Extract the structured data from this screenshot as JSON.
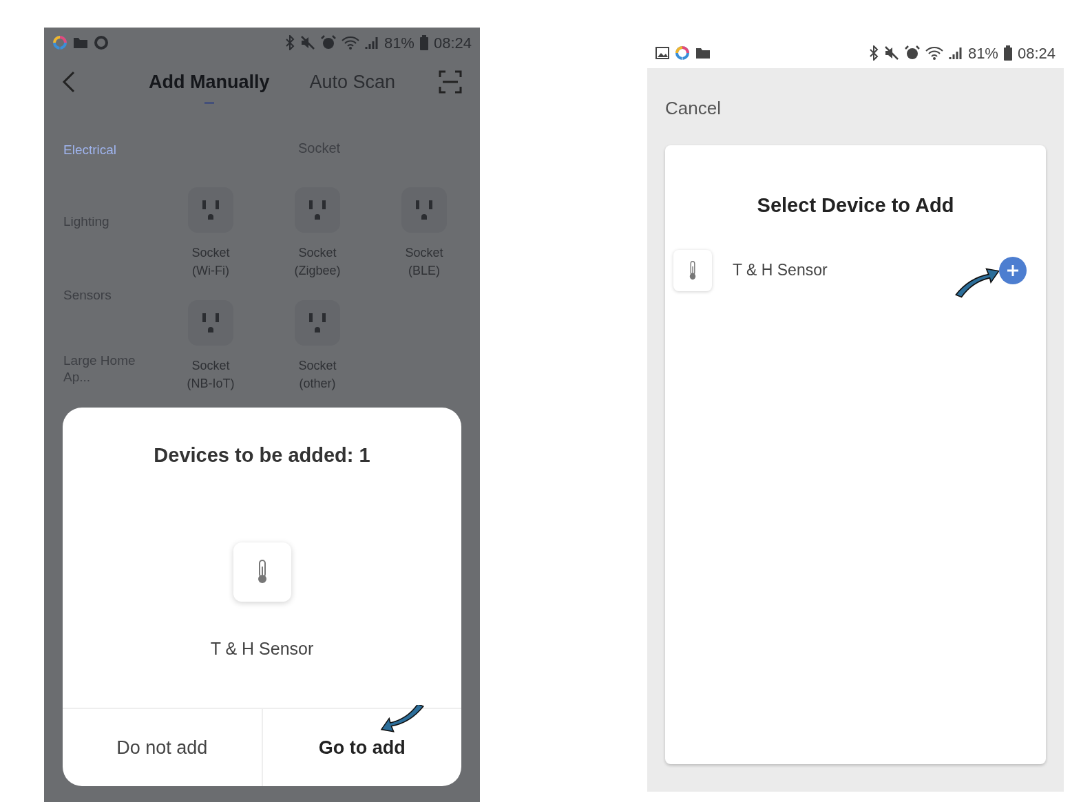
{
  "left_screen": {
    "status_bar": {
      "battery": "81%",
      "time": "08:24"
    },
    "tabs": [
      {
        "label": "Add Manually",
        "selected": true
      },
      {
        "label": "Auto Scan",
        "selected": false
      }
    ],
    "categories": [
      {
        "label": "Electrical",
        "selected": true
      },
      {
        "label": "Lighting",
        "selected": false
      },
      {
        "label": "Sensors",
        "selected": false
      },
      {
        "label": "Large Home Ap...",
        "selected": false
      }
    ],
    "section_title": "Socket",
    "devices": [
      {
        "name": "Socket",
        "variant": "(Wi-Fi)"
      },
      {
        "name": "Socket",
        "variant": "(Zigbee)"
      },
      {
        "name": "Socket",
        "variant": "(BLE)"
      },
      {
        "name": "Socket",
        "variant": "(NB-IoT)"
      },
      {
        "name": "Socket",
        "variant": "(other)"
      }
    ],
    "dialog": {
      "title": "Devices to be added: 1",
      "device": "T & H Sensor",
      "buttons": [
        {
          "label": "Do not add",
          "kind": "secondary"
        },
        {
          "label": "Go to add",
          "kind": "primary"
        }
      ]
    }
  },
  "right_screen": {
    "status_bar": {
      "battery": "81%",
      "time": "08:24"
    },
    "cancel": "Cancel",
    "title": "Select Device to Add",
    "devices": [
      {
        "name": "T & H Sensor"
      }
    ]
  }
}
